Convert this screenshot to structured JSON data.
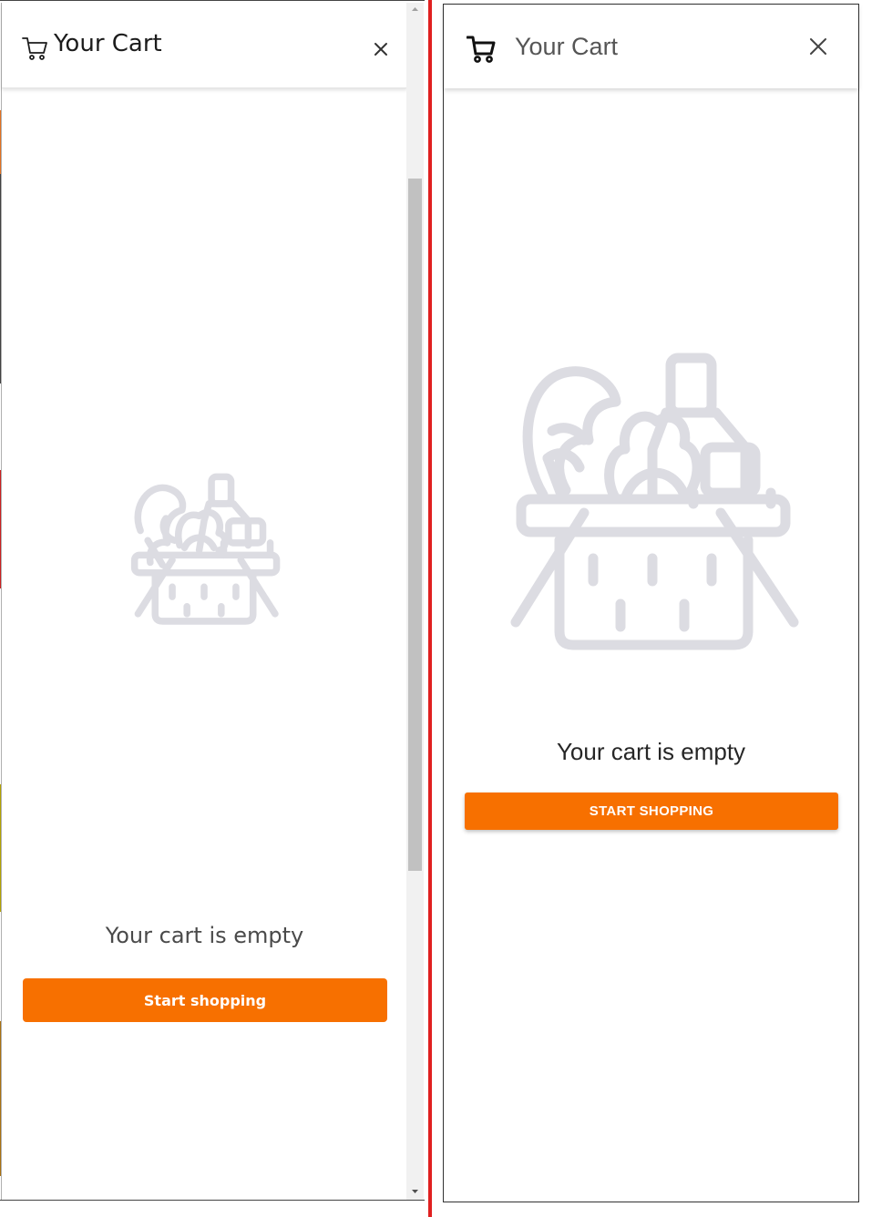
{
  "left_panel": {
    "header": {
      "title": "Your Cart",
      "cart_icon": "shopping-cart-icon",
      "close_icon": "close-icon"
    },
    "illustration": "grocery-basket-icon",
    "empty_message": "Your cart is empty",
    "button_label": "Start shopping"
  },
  "right_panel": {
    "header": {
      "title": "Your Cart",
      "cart_icon": "shopping-cart-icon",
      "close_icon": "close-icon"
    },
    "illustration": "grocery-basket-icon",
    "empty_message": "Your cart is empty",
    "button_label": "START SHOPPING"
  },
  "colors": {
    "accent": "#f77000",
    "illustration": "#dcdce2",
    "divider": "#e02020"
  }
}
